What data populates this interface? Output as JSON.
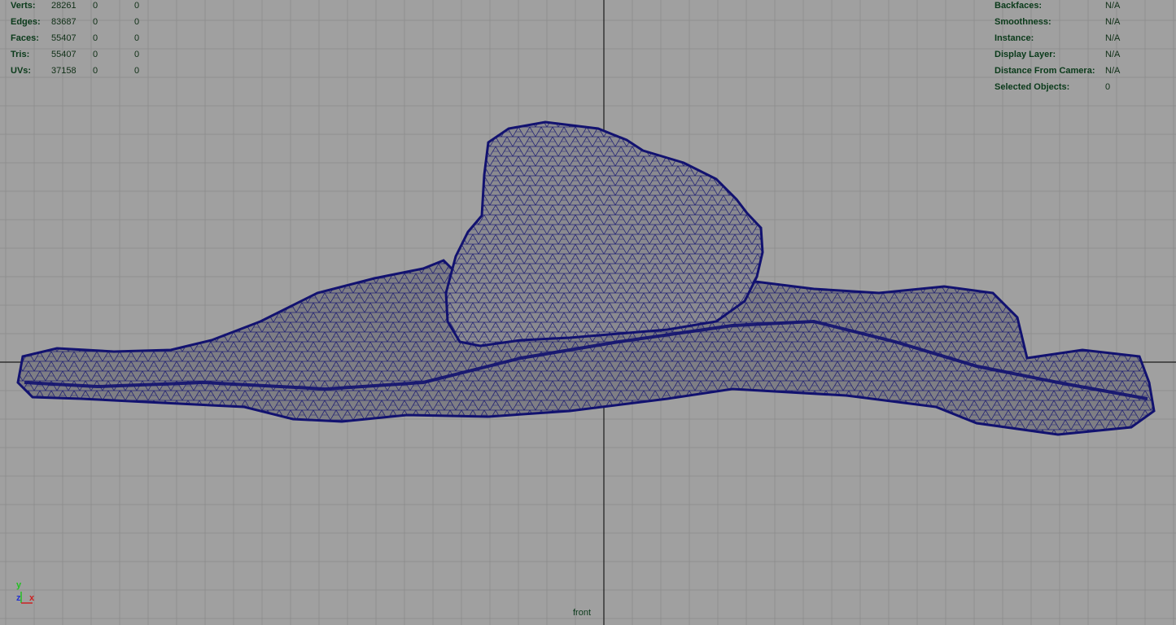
{
  "viewport": {
    "camera": "front",
    "background_color": "#a0a0a0",
    "grid_color": "#8f8f8f",
    "axis_line_color": "#1a1a1a",
    "wireframe_color": "#121270",
    "mesh_fill_color": "#7a7a80"
  },
  "poly_stats": [
    {
      "label": "Verts:",
      "a": "28261",
      "b": "0",
      "c": "0"
    },
    {
      "label": "Edges:",
      "a": "83687",
      "b": "0",
      "c": "0"
    },
    {
      "label": "Faces:",
      "a": "55407",
      "b": "0",
      "c": "0"
    },
    {
      "label": "Tris:",
      "a": "55407",
      "b": "0",
      "c": "0"
    },
    {
      "label": "UVs:",
      "a": "37158",
      "b": "0",
      "c": "0"
    }
  ],
  "object_info": [
    {
      "label": "Backfaces:",
      "value": "N/A"
    },
    {
      "label": "Smoothness:",
      "value": "N/A"
    },
    {
      "label": "Instance:",
      "value": "N/A"
    },
    {
      "label": "Display Layer:",
      "value": "N/A"
    },
    {
      "label": "Distance From Camera:",
      "value": "N/A"
    },
    {
      "label": "Selected Objects:",
      "value": "0"
    }
  ],
  "axis_gizmo": {
    "y_label": "y",
    "z_label": "z",
    "x_label": "x",
    "y_color": "#22c022",
    "z_color": "#2233cc",
    "x_color": "#cc2222"
  }
}
